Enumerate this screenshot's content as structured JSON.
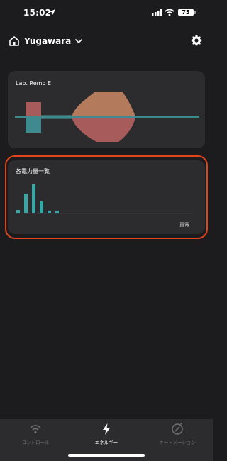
{
  "status": {
    "time": "15:02",
    "battery": "75"
  },
  "header": {
    "home_name": "Yugawara"
  },
  "cards": {
    "device": {
      "title": "Lab. Remo E"
    },
    "energy": {
      "title": "各電力量一覧",
      "legend": "買電",
      "bar_levels": [
        0.12,
        0.68,
        1.0,
        0.42,
        0.1,
        0.1
      ]
    }
  },
  "tabs": [
    {
      "label": "コントロール",
      "icon": "wifi-icon"
    },
    {
      "label": "エネルギー",
      "icon": "lightning-icon"
    },
    {
      "label": "オートメーション",
      "icon": "automation-icon"
    }
  ],
  "colors": {
    "accent_highlight": "#e0451b",
    "bar": "#3aa7a7",
    "wave_orange": "#b37a5c",
    "wave_red": "#a85b5b",
    "wave_teal": "#3e8a8f"
  }
}
